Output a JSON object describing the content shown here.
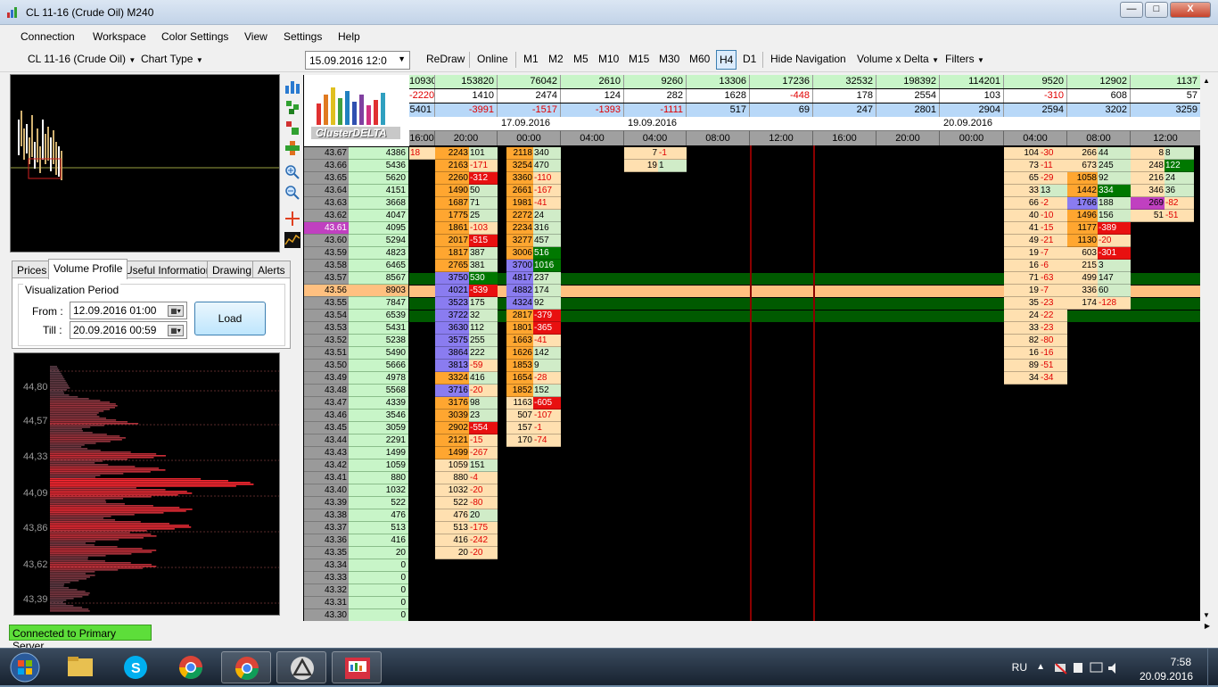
{
  "window": {
    "title": "CL 11-16 (Crude Oil) M240",
    "min": "—",
    "max": "□",
    "close": "X"
  },
  "menu": [
    "Connection",
    "Workspace",
    "Color Settings",
    "View",
    "Settings",
    "Help"
  ],
  "toolbar": {
    "instrument": "CL 11-16 (Crude Oil)",
    "chart_type": "Chart Type",
    "date_value": "15.09.2016 12:0",
    "buttons": [
      "ReDraw",
      "Online",
      "M1",
      "M2",
      "M5",
      "M10",
      "M15",
      "M30",
      "M60",
      "H4",
      "D1",
      "Hide Navigation",
      "Volume x Delta",
      "Filters"
    ],
    "active": "H4"
  },
  "tabs": [
    "Prices",
    "Volume Profile",
    "Useful Information",
    "Drawing",
    "Alerts"
  ],
  "active_tab": "Volume Profile",
  "viz": {
    "group": "Visualization Period",
    "from_label": "From :",
    "till_label": "Till :",
    "from_value": "12.09.2016 01:00",
    "till_value": "20.09.2016 00:59",
    "load": "Load"
  },
  "profile_labels": [
    "44,80",
    "44,57",
    "44,33",
    "44,09",
    "43,86",
    "43,62",
    "43,39"
  ],
  "status": "Connected to Primary Server",
  "logo_text": "ClusterDELTA",
  "header": {
    "vol": [
      "10930",
      "153820",
      "76042",
      "2610",
      "9260",
      "13306",
      "17236",
      "32532",
      "198392",
      "114201",
      "9520",
      "12902",
      "1137"
    ],
    "delta": [
      "-2220",
      "1410",
      "2474",
      "124",
      "282",
      "1628",
      "-448",
      "178",
      "2554",
      "103",
      "-310",
      "608",
      "57"
    ],
    "cum": [
      "5401",
      "-3991",
      "-1517",
      "-1393",
      "-1111",
      "517",
      "69",
      "247",
      "2801",
      "2904",
      "2594",
      "3202",
      "3259"
    ],
    "dates": [
      "17.09.2016",
      "19.09.2016",
      "20.09.2016"
    ],
    "times": [
      "16:00",
      "20:00",
      "00:00",
      "04:00",
      "04:00",
      "08:00",
      "12:00",
      "16:00",
      "20:00",
      "00:00",
      "04:00",
      "08:00",
      "12:00"
    ]
  },
  "prices": [
    "43.67",
    "43.66",
    "43.65",
    "43.64",
    "43.63",
    "43.62",
    "43.61",
    "43.60",
    "43.59",
    "43.58",
    "43.57",
    "43.56",
    "43.55",
    "43.54",
    "43.53",
    "43.52",
    "43.51",
    "43.50",
    "43.49",
    "43.48",
    "43.47",
    "43.46",
    "43.45",
    "43.44",
    "43.43",
    "43.42",
    "43.41",
    "43.40",
    "43.39",
    "43.38",
    "43.37",
    "43.36",
    "43.35",
    "43.34",
    "43.33",
    "43.32",
    "43.31",
    "43.30"
  ],
  "total_vol": [
    "4386",
    "5436",
    "5620",
    "4151",
    "3668",
    "4047",
    "4095",
    "5294",
    "4823",
    "6465",
    "8567",
    "8903",
    "7847",
    "6539",
    "5431",
    "5238",
    "5490",
    "5666",
    "4978",
    "5568",
    "4339",
    "3546",
    "3059",
    "2291",
    "1499",
    "1059",
    "880",
    "1032",
    "522",
    "476",
    "513",
    "416",
    "20",
    "0",
    "0",
    "0",
    "0",
    "0"
  ],
  "col_0": [
    [
      "",
      "18"
    ]
  ],
  "col_1": [
    [
      "2243",
      "101"
    ],
    [
      "2163",
      "-171"
    ],
    [
      "2260",
      "-312"
    ],
    [
      "1490",
      "50"
    ],
    [
      "1687",
      "71"
    ],
    [
      "1775",
      "25"
    ],
    [
      "1861",
      "-103"
    ],
    [
      "2017",
      "-515"
    ],
    [
      "1817",
      "387"
    ],
    [
      "2765",
      "381"
    ],
    [
      "3750",
      "530"
    ],
    [
      "4021",
      "-539"
    ],
    [
      "3523",
      "175"
    ],
    [
      "3722",
      "32"
    ],
    [
      "3630",
      "112"
    ],
    [
      "3575",
      "255"
    ],
    [
      "3864",
      "222"
    ],
    [
      "3813",
      "-59"
    ],
    [
      "3324",
      "416"
    ],
    [
      "3716",
      "-20"
    ],
    [
      "3176",
      "98"
    ],
    [
      "3039",
      "23"
    ],
    [
      "2902",
      "-554"
    ],
    [
      "2121",
      "-15"
    ],
    [
      "1499",
      "-267"
    ],
    [
      "1059",
      "151"
    ],
    [
      "880",
      "-4"
    ],
    [
      "1032",
      "-20"
    ],
    [
      "522",
      "-80"
    ],
    [
      "476",
      "20"
    ],
    [
      "513",
      "-175"
    ],
    [
      "416",
      "-242"
    ],
    [
      "20",
      "-20"
    ]
  ],
  "col_2": [
    [
      "2118",
      "340"
    ],
    [
      "3254",
      "470"
    ],
    [
      "3360",
      "-110"
    ],
    [
      "2661",
      "-167"
    ],
    [
      "1981",
      "-41"
    ],
    [
      "2272",
      "24"
    ],
    [
      "2234",
      "316"
    ],
    [
      "3277",
      "457"
    ],
    [
      "3006",
      "516"
    ],
    [
      "3700",
      "1016"
    ],
    [
      "4817",
      "237"
    ],
    [
      "4882",
      "174"
    ],
    [
      "4324",
      "92"
    ],
    [
      "2817",
      "-379"
    ],
    [
      "1801",
      "-365"
    ],
    [
      "1663",
      "-41"
    ],
    [
      "1626",
      "142"
    ],
    [
      "1853",
      "9"
    ],
    [
      "1654",
      "-28"
    ],
    [
      "1852",
      "152"
    ],
    [
      "1163",
      "-605"
    ],
    [
      "507",
      "-107"
    ],
    [
      "157",
      "-1"
    ],
    [
      "170",
      "-74"
    ]
  ],
  "col_4": [
    [
      "7",
      "-1"
    ],
    [
      "19",
      "1"
    ]
  ],
  "col_10": [
    [
      "104",
      "-30"
    ],
    [
      "73",
      "-11"
    ],
    [
      "65",
      "-29"
    ],
    [
      "33",
      "13"
    ],
    [
      "66",
      "-2"
    ],
    [
      "40",
      "-10"
    ],
    [
      "41",
      "-15"
    ],
    [
      "49",
      "-21"
    ],
    [
      "19",
      "-7"
    ],
    [
      "16",
      "-6"
    ],
    [
      "71",
      "-63"
    ],
    [
      "19",
      "-7"
    ],
    [
      "35",
      "-23"
    ],
    [
      "24",
      "-22"
    ],
    [
      "33",
      "-23"
    ],
    [
      "82",
      "-80"
    ],
    [
      "16",
      "-16"
    ],
    [
      "89",
      "-51"
    ],
    [
      "34",
      "-34"
    ]
  ],
  "col_11": [
    [
      "266",
      "44"
    ],
    [
      "673",
      "245"
    ],
    [
      "1058",
      "92"
    ],
    [
      "1442",
      "334"
    ],
    [
      "1766",
      "188"
    ],
    [
      "1496",
      "156"
    ],
    [
      "1177",
      "-389"
    ],
    [
      "1130",
      "-20"
    ],
    [
      "603",
      "-301"
    ],
    [
      "215",
      "3"
    ],
    [
      "499",
      "147"
    ],
    [
      "336",
      "60"
    ],
    [
      "174",
      "-128"
    ]
  ],
  "col_12": [
    [
      "8",
      "8"
    ],
    [
      "248",
      "122"
    ],
    [
      "216",
      "24"
    ],
    [
      "346",
      "36"
    ],
    [
      "269",
      "-82"
    ],
    [
      "51",
      "-51"
    ]
  ],
  "taskbar": {
    "lang": "RU",
    "time": "7:58",
    "date": "20.09.2016"
  },
  "colors": {
    "volume_orange": "#ffa630",
    "volume_light": "#ffe0b0",
    "volume_blue": "#8a7cf0",
    "delta_pos": "#c8e6c0",
    "delta_neg": "#ffe0b0",
    "delta_strong_pos": "#007800",
    "delta_strong_neg": "#e81010",
    "poc_band": "#ffc080",
    "value_band": "#005a00"
  }
}
